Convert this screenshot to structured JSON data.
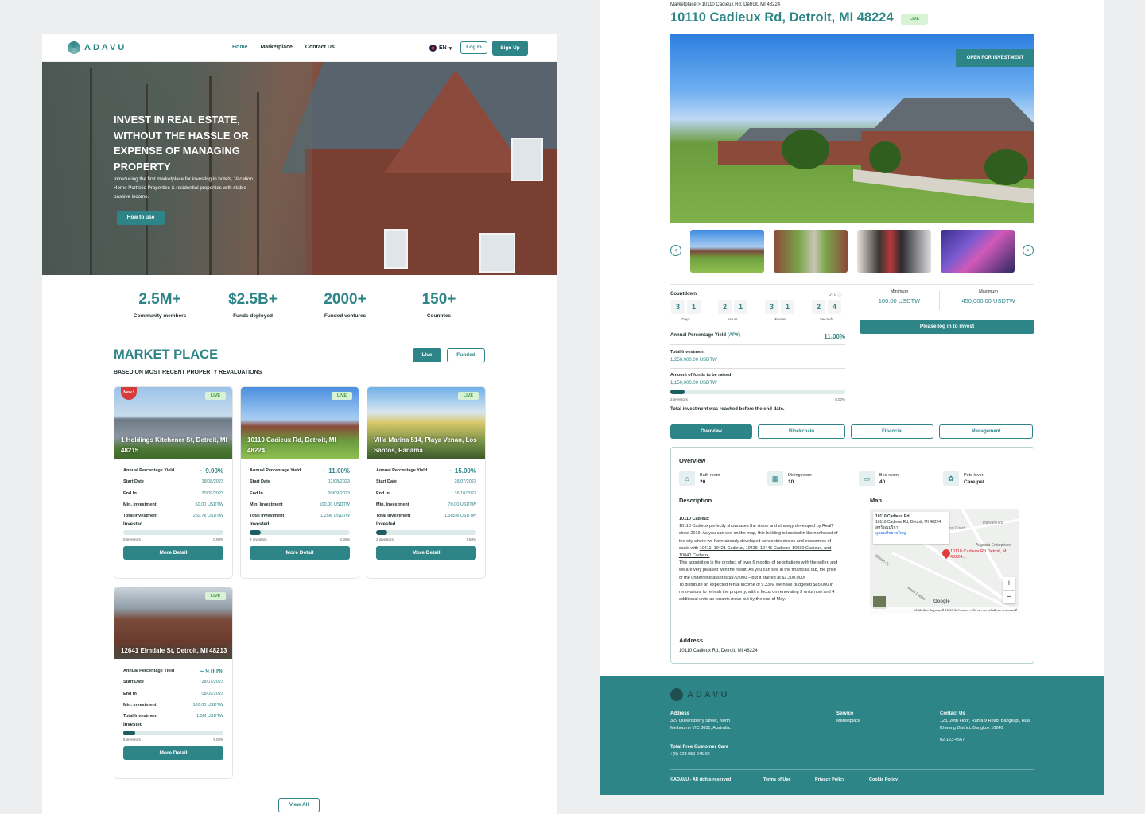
{
  "left": {
    "brand": "ADAVU",
    "nav": {
      "home": "Home",
      "marketplace": "Marketplace",
      "contact": "Contact Us",
      "lang": "EN",
      "login": "Log In",
      "signup": "Sign Up"
    },
    "hero": {
      "title": "Invest in real estate, without the hassle or expense of managing property",
      "subtitle": "Introducing the first marketplace for investing in hotels, Vacation Home Portfolio Properties & residential properties with stable passive income.",
      "cta": "How to use"
    },
    "stats": [
      {
        "num": "2.5M+",
        "label": "Community members"
      },
      {
        "num": "$2.5B+",
        "label": "Funds deployed"
      },
      {
        "num": "2000+",
        "label": "Funded ventures"
      },
      {
        "num": "150+",
        "label": "Countries"
      }
    ],
    "market": {
      "title": "MARKET PLACE",
      "subtitle": "BASED ON MOST RECENT PROPERTY REVALUATIONS",
      "tab_live": "Live",
      "tab_funded": "Funded",
      "labels": {
        "apy": "Annual Percentage Yield",
        "start": "Start Date",
        "end": "End In",
        "min": "Min. Investment",
        "total": "Total Investment",
        "invested": "Invested",
        "button": "More Detail",
        "live": "LIVE",
        "new": "New !"
      },
      "cards": [
        {
          "name": "1 Holdings Kitchener St, Detroit, MI 48215",
          "apy": "~ 9.00%",
          "start": "18/08/2023",
          "end": "30/09/2023",
          "min": "50.00 USDTW",
          "total": "259.7k USDTW",
          "investors": "0 investors",
          "pct": "0.00%",
          "progress": 0.0
        },
        {
          "name": "10110 Cadieux Rd, Detroit, MI 48224",
          "apy": "~ 11.00%",
          "start": "11/08/2023",
          "end": "20/09/2023",
          "min": "100.00 USDTW",
          "total": "1.25M USDTW",
          "investors": "2 investors",
          "pct": "8.00%",
          "progress": 0.08
        },
        {
          "name": "Villa Marina 514, Playa Venao, Los Santos, Panama",
          "apy": "~ 15.00%",
          "start": "28/07/2023",
          "end": "16/10/2023",
          "min": "70.00 USDTW",
          "total": "1.385M USDTW",
          "investors": "2 investors",
          "pct": "7.58%",
          "progress": 0.0758
        },
        {
          "name": "12641 Elmdale St, Detroit, MI 48213",
          "apy": "~ 9.00%",
          "start": "28/07/2023",
          "end": "08/09/2023",
          "min": "100.00 USDTW",
          "total": "1.5M USDTW",
          "investors": "5 investors",
          "pct": "9.03%",
          "progress": 0.0903
        }
      ],
      "view_all": "View All"
    }
  },
  "right": {
    "breadcrumb": "Marketplace > 10110 Cadieux Rd, Detroit, MI 48224",
    "title": "10110 Cadieux Rd, Detroit, MI 48224",
    "live": "LIVE",
    "open_badge": "OPEN FOR INVESTMENT",
    "countdown": {
      "title": "Countdown",
      "utc": "UTC",
      "units": [
        {
          "digits": [
            "3",
            "1"
          ],
          "label": "Days"
        },
        {
          "digits": [
            "2",
            "1"
          ],
          "label": "Hours"
        },
        {
          "digits": [
            "3",
            "1"
          ],
          "label": "Minutes"
        },
        {
          "digits": [
            "2",
            "4"
          ],
          "label": "Seconds"
        }
      ]
    },
    "minimum_label": "Minimum",
    "minimum": "100.00 USDTW",
    "maximum_label": "Maximum",
    "maximum": "450,000.00 USDTW",
    "login_button": "Please log in to invest",
    "apy_label": "Annual Percentage Yield",
    "apy_tag": "(APY)",
    "apy": "11.00%",
    "total_label": "Total Investment",
    "total": "1,250,000.00 USDTW",
    "raise_label": "Amount of funds to be raised",
    "raise": "1,150,000.00 USDTW",
    "progress": 0.08,
    "investors": "2 investors",
    "pct": "8.00%",
    "reached": "Total investment was reached before the end date.",
    "tabs": [
      "Overview",
      "Blockchain",
      "Financial",
      "Management"
    ],
    "overview": {
      "title": "Overview",
      "items": [
        {
          "label": "Bath room",
          "value": "20",
          "icon": "bath-icon"
        },
        {
          "label": "Dining room",
          "value": "10",
          "icon": "dining-icon"
        },
        {
          "label": "Bed room",
          "value": "40",
          "icon": "bed-icon"
        },
        {
          "label": "Pets lover",
          "value": "Care pet",
          "icon": "paw-icon"
        }
      ],
      "desc_title": "Description",
      "desc_heading": "10110 Cadieux",
      "desc_p1": "10110 Cadieux perfectly showcases the vision and strategy developed by RealT since 2019. As you can see on the map, this building is located in the northwest of the city where we have already developed concentric circles and economies of scale with",
      "desc_links": "10411–10421 Cadieux, 10435–10445 Cadieux, 10030 Cadieux, and 10040 Cadieux.",
      "desc_p2": "This acquisition is the product of over 6 months of negotiations with the seller, and we are very pleased with the result. As you can see in the financials tab, the price of the underlying asset is $970,000 – but it started at $1,300,000!",
      "desc_p3": "To distribute an expected rental income of 9.33%, we have budgeted $65,000 in renovations to refresh the property, with a focus on renovating 3 units now and 4 additional units as tenants move out by the end of May.",
      "map_title": "Map",
      "map_card_title": "10110 Cadieux Rd",
      "map_card_addr": "10110 Cadieux Rd, Detroit, MI 48224",
      "map_card_sub": "สหรัฐอเมริกา",
      "map_card_link": "ดูแผนที่ขยายใหญ่",
      "map_pin": "10110 Cadieux Rd Detroit, MI 48224...",
      "map_places": [
        "nd Court",
        "Augusta Enterprises",
        "Avon Lodge",
        "Britain St",
        "Harvard Rd",
        "Google"
      ],
      "map_zoom_in": "+",
      "map_zoom_out": "−",
      "map_footer": "แป้นพิมพ์ลัด   ข้อมูลแผนที่ ©2023   ข้อกำหนดการใช้งาน   รายงานข้อผิดพลาดของแผนที่",
      "address_title": "Address",
      "address": "10110 Cadieux Rd, Detroit, MI 48224"
    },
    "footer": {
      "brand": "ADAVU",
      "address_h": "Address",
      "address": "329 Queensberry Street, North Melbourne VIC 3051, Australia.",
      "care_h": "Total Free Customer Care",
      "care": "+(0) 123 050 945 02",
      "service_h": "Service",
      "service": "Marketplace",
      "contact_h": "Contact Us",
      "contact": "123, 20th Floor, Rama 9 Road, Bangkapi, Huai Khwang District, Bangkok 10240",
      "phone": "02-123-4567",
      "copyright": "©ADAVU - All rights reserved",
      "terms": "Terms of Use",
      "privacy": "Privacy Policy",
      "cookie": "Cookie Policy"
    }
  }
}
